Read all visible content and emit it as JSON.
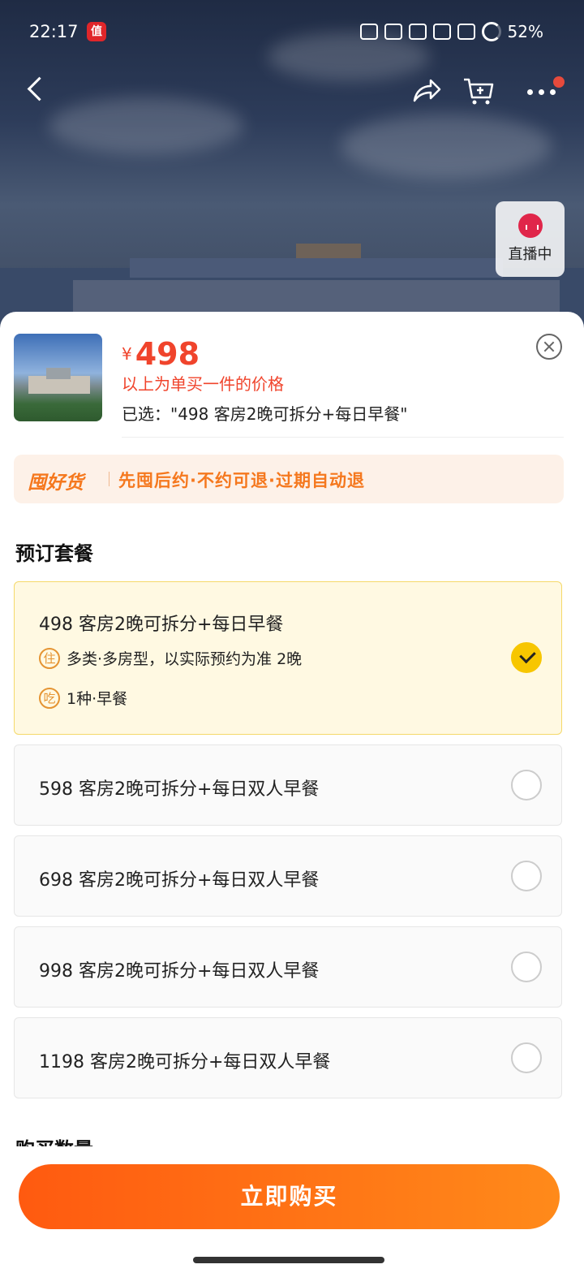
{
  "status_bar": {
    "time": "22:17",
    "app_badge": "值",
    "battery": "52%"
  },
  "hero": {
    "live_label": "直播中"
  },
  "product": {
    "currency": "¥",
    "price": "498",
    "price_note": "以上为单买一件的价格",
    "selected": "已选：\"498 客房2晚可拆分+每日早餐\""
  },
  "promo": {
    "brand": "囤好货",
    "text": "先囤后约·不约可退·过期自动退"
  },
  "packages_title": "预订套餐",
  "packages": [
    {
      "label": "498 客房2晚可拆分+每日早餐",
      "selected": true,
      "details": [
        {
          "tag": "住",
          "text": "多类·多房型，以实际预约为准 2晚"
        },
        {
          "tag": "吃",
          "text": "1种·早餐"
        }
      ]
    },
    {
      "label": "598 客房2晚可拆分+每日双人早餐",
      "selected": false
    },
    {
      "label": "698 客房2晚可拆分+每日双人早餐",
      "selected": false
    },
    {
      "label": "998 客房2晚可拆分+每日双人早餐",
      "selected": false
    },
    {
      "label": "1198 客房2晚可拆分+每日双人早餐",
      "selected": false
    }
  ],
  "quantity_title": "购买数量",
  "buy_button": "立即购买",
  "colors": {
    "accent": "#f0442c",
    "promo": "#f5781e",
    "selected_bg": "#fff9e2",
    "check": "#f7c600",
    "button_start": "#ff5a10",
    "button_end": "#ff8a1a"
  }
}
